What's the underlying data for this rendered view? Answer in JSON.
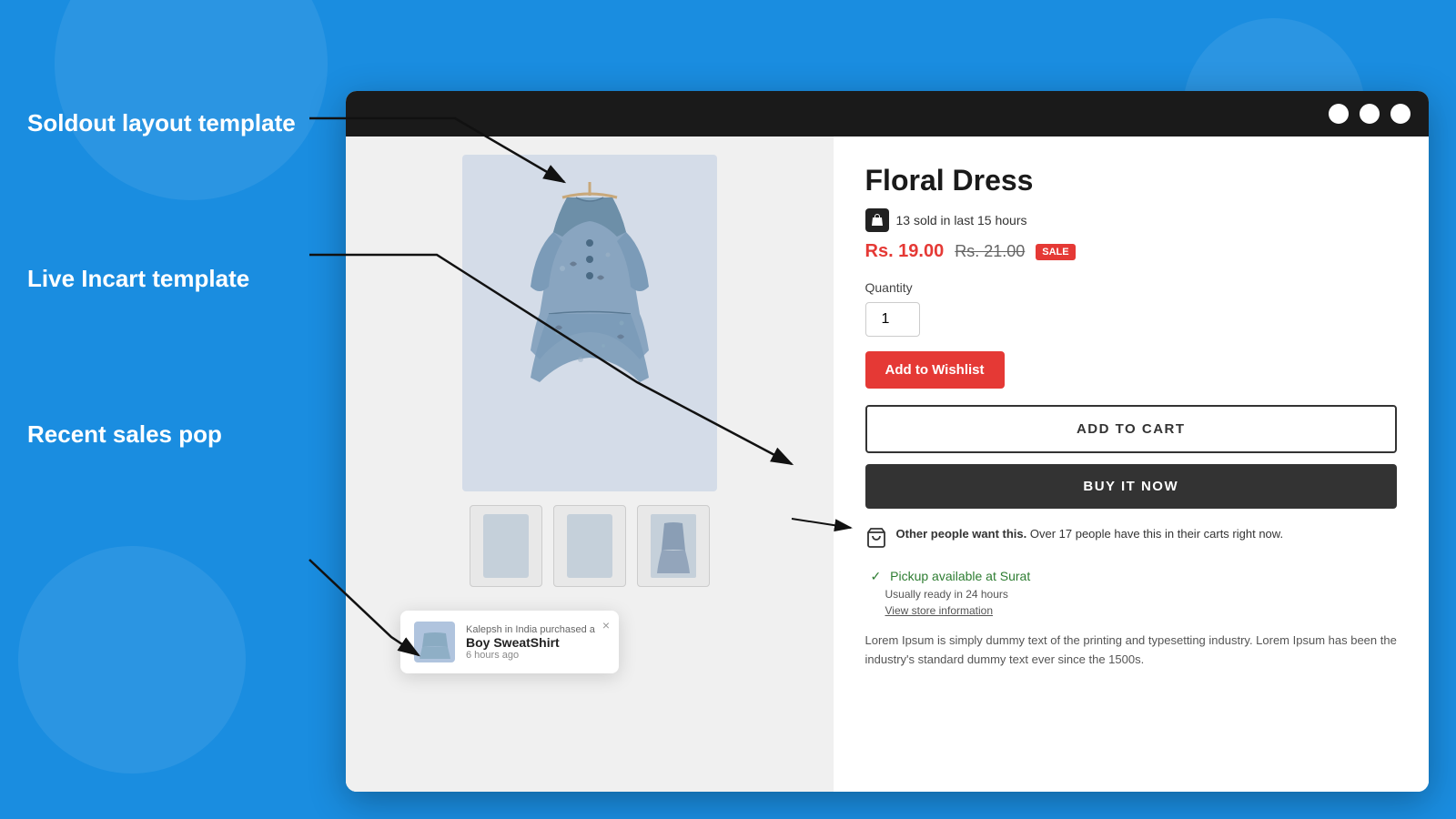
{
  "page": {
    "background_color": "#1a8de0",
    "title": "Soldout layout template"
  },
  "left_labels": {
    "label1": "Soldout layout template",
    "label2": "Live Incart template",
    "label3": "Recent sales pop"
  },
  "browser": {
    "title": "Soldout layout template",
    "dots": [
      "white",
      "white",
      "white"
    ]
  },
  "product": {
    "title": "Floral Dress",
    "sold_info": "13 sold in last 15 hours",
    "price_current": "Rs. 19.00",
    "price_original": "Rs. 21.00",
    "sale_badge": "SALE",
    "quantity_label": "Quantity",
    "quantity_value": "1",
    "wishlist_button": "Add to Wishlist",
    "add_to_cart_button": "ADD TO CART",
    "buy_now_button": "BUY IT NOW",
    "incart_text_bold": "Other people want this.",
    "incart_text": " Over 17 people have this in their carts right now.",
    "pickup_check": "✓",
    "pickup_location": "Pickup available at Surat",
    "pickup_ready": "Usually ready in 24 hours",
    "view_store": "View store information",
    "description": "Lorem Ipsum is simply dummy text of the printing and typesetting industry. Lorem Ipsum has been the industry's standard dummy text ever since the 1500s."
  },
  "sales_popup": {
    "purchased_text": "Kalepsh in India purchased a",
    "product_name": "Boy SweatShirt",
    "time_ago": "6 hours ago",
    "close_btn": "×"
  }
}
